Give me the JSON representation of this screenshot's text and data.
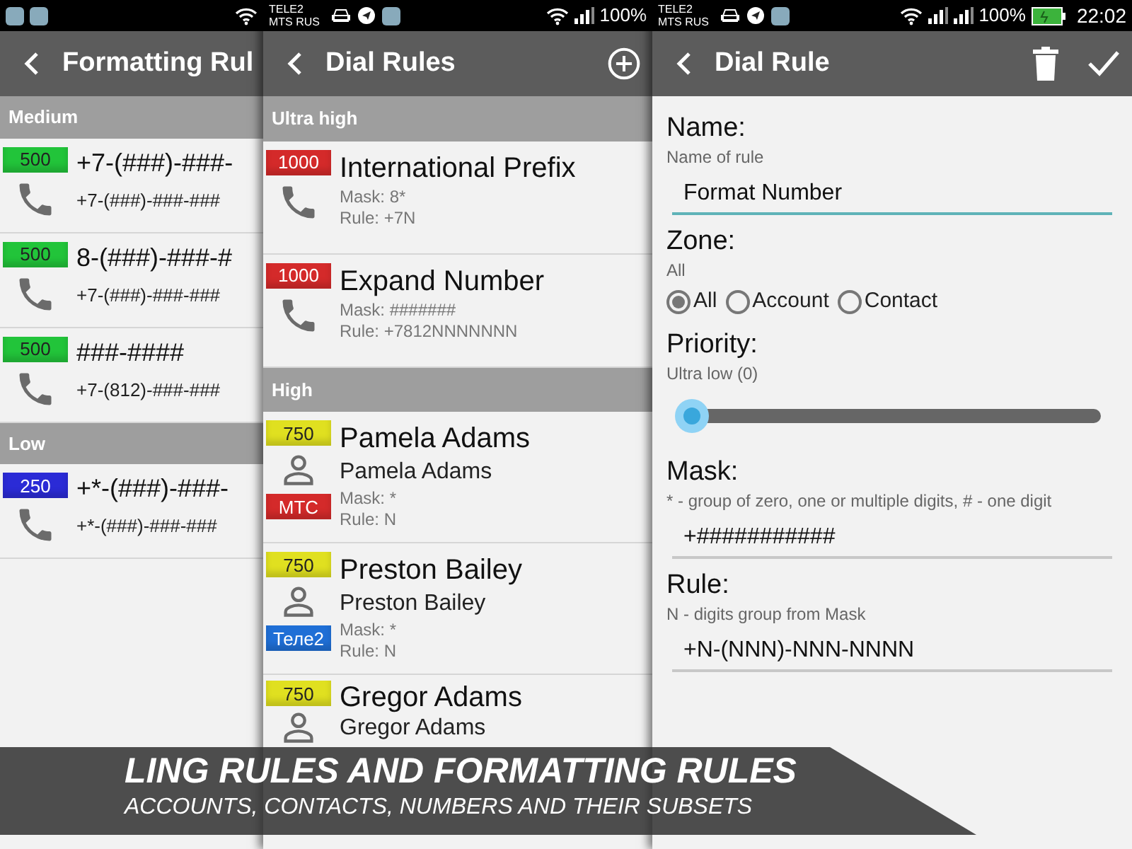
{
  "panels": [
    {
      "kind": "list",
      "title": "Formatting Rul",
      "sections": [
        {
          "title": "Medium",
          "items": [
            {
              "kind": "number",
              "priority": "500",
              "color": "#22c43a",
              "title": "+7-(###)-###-",
              "subtitle": "+7-(###)-###-###"
            },
            {
              "kind": "number",
              "priority": "500",
              "color": "#22c43a",
              "title": "8-(###)-###-#",
              "subtitle": "+7-(###)-###-###"
            },
            {
              "kind": "number",
              "priority": "500",
              "color": "#22c43a",
              "title": "###-####",
              "subtitle": "+7-(812)-###-###"
            }
          ]
        },
        {
          "title": "Low",
          "items": [
            {
              "kind": "number",
              "priority": "250",
              "color": "#2b2bd6",
              "title": "+*-(###)-###-",
              "subtitle": "+*-(###)-###-###"
            }
          ]
        }
      ]
    },
    {
      "kind": "list",
      "status_bar": {
        "carrier": [
          "TELE2",
          "MTS RUS"
        ],
        "battery_percent": "100%"
      },
      "title": "Dial Rules",
      "sections": [
        {
          "title": "Ultra high",
          "items": [
            {
              "kind": "number",
              "priority": "1000",
              "color": "#d42a2a",
              "title": "International Prefix",
              "lines": [
                "Mask: 8*",
                "Rule: +7N"
              ]
            },
            {
              "kind": "number",
              "priority": "1000",
              "color": "#d42a2a",
              "title": "Expand Number",
              "lines": [
                "Mask: #######",
                "Rule: +7812NNNNNNN"
              ]
            }
          ]
        },
        {
          "title": "High",
          "items": [
            {
              "kind": "contact",
              "priority": "750",
              "color": "#e0e020",
              "title": "Pamela Adams",
              "subtitle": "Pamela Adams",
              "sim": {
                "label": "MTC",
                "color": "#d42a2a"
              },
              "lines": [
                "Mask: *",
                "Rule: N"
              ]
            },
            {
              "kind": "contact",
              "priority": "750",
              "color": "#e0e020",
              "title": "Preston Bailey",
              "subtitle": "Preston Bailey",
              "sim": {
                "label": "Теле2",
                "color": "#1f6fd6"
              },
              "lines": [
                "Mask: *",
                "Rule: N"
              ]
            },
            {
              "kind": "contact",
              "priority": "750",
              "color": "#e0e020",
              "title": "Gregor Adams",
              "subtitle": "Gregor Adams"
            }
          ]
        }
      ]
    },
    {
      "kind": "form",
      "status_bar": {
        "carrier": [
          "TELE2",
          "MTS RUS"
        ],
        "battery_percent": "100%",
        "time": "22:02"
      },
      "title": "Dial Rule",
      "fields": [
        {
          "kind": "text",
          "label": "Name:",
          "hint": "Name of rule",
          "value": "Format Number",
          "focused": true
        },
        {
          "kind": "radio",
          "label": "Zone:",
          "hint": "All",
          "options": [
            {
              "label": "All",
              "selected": true
            },
            {
              "label": "Account",
              "selected": false
            },
            {
              "label": "Contact",
              "selected": false
            }
          ]
        },
        {
          "kind": "slider",
          "label": "Priority:",
          "hint": "Ultra low (0)",
          "level": 0.02
        },
        {
          "kind": "text",
          "label": "Mask:",
          "hint": "* - group of zero, one or multiple digits, # - one digit",
          "value": "+###########",
          "focused": false
        },
        {
          "kind": "text",
          "label": "Rule:",
          "hint": "N - digits group from Mask",
          "value": "+N-(NNN)-NNN-NNNN",
          "focused": false
        }
      ]
    }
  ],
  "banner": {
    "headline": "LING RULES AND FORMATTING RULES",
    "subline": "ACCOUNTS, CONTACTS, NUMBERS AND THEIR SUBSETS"
  }
}
